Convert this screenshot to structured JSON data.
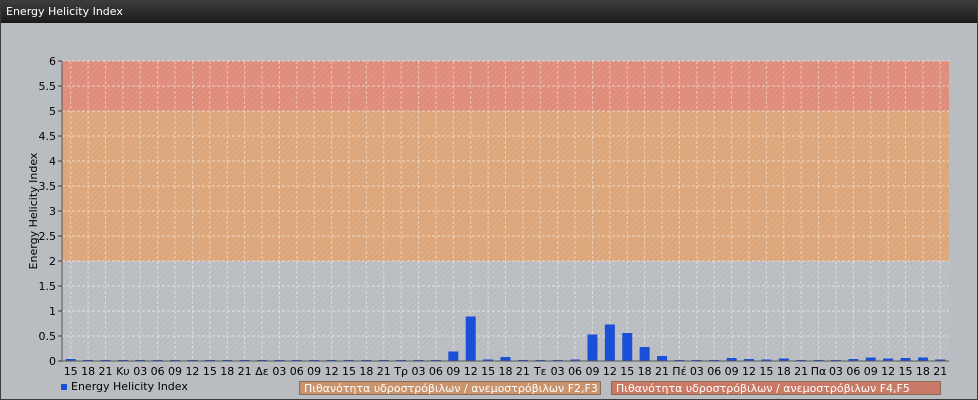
{
  "window": {
    "title": "Energy Helicity Index"
  },
  "colors": {
    "bar": "#1a4fd8",
    "zone_low": "#b9bdc1",
    "zone_f23": "#dca67a",
    "zone_f45": "#df8c7a"
  },
  "legend": {
    "series_label": "Energy Helicity Index",
    "zone_f23_label": "Πιθανότητα υδροστρόβιλων / ανεμοστρόβιλων F2,F3",
    "zone_f45_label": "Πιθανότητα υδροστρόβιλων / ανεμοστρόβιλων F4,F5"
  },
  "chart_data": {
    "type": "bar",
    "title": "Energy Helicity Index",
    "xlabel": "",
    "ylabel": "Energy Helicity Index",
    "ylim": [
      0,
      6
    ],
    "yticks": [
      "0",
      "0.5",
      "1",
      "1.5",
      "2",
      "2.5",
      "3",
      "3.5",
      "4",
      "4.5",
      "5",
      "5.5",
      "6"
    ],
    "grid": true,
    "bands": [
      {
        "from": 2,
        "to": 5,
        "label": "Πιθανότητα υδροστρόβιλων / ανεμοστρόβιλων F2,F3"
      },
      {
        "from": 5,
        "to": 6,
        "label": "Πιθανότητα υδροστρόβιλων / ανεμοστρόβιλων F4,F5"
      }
    ],
    "categories": [
      "15",
      "18",
      "21",
      "Κυ",
      "03",
      "06",
      "09",
      "12",
      "15",
      "18",
      "21",
      "Δε",
      "03",
      "06",
      "09",
      "12",
      "15",
      "18",
      "21",
      "Τρ",
      "03",
      "06",
      "09",
      "12",
      "15",
      "18",
      "21",
      "Τε",
      "03",
      "06",
      "09",
      "12",
      "15",
      "18",
      "21",
      "Πέ",
      "03",
      "06",
      "09",
      "12",
      "15",
      "18",
      "21",
      "Πα",
      "03",
      "06",
      "09",
      "12",
      "15",
      "18",
      "21"
    ],
    "series": [
      {
        "name": "Energy Helicity Index",
        "values": [
          0.04,
          0.02,
          0.02,
          0.02,
          0.02,
          0.02,
          0.02,
          0.02,
          0.02,
          0.02,
          0.02,
          0.02,
          0.02,
          0.02,
          0.02,
          0.02,
          0.02,
          0.02,
          0.02,
          0.02,
          0.02,
          0.02,
          0.19,
          0.89,
          0.03,
          0.08,
          0.02,
          0.02,
          0.02,
          0.03,
          0.53,
          0.73,
          0.56,
          0.28,
          0.1,
          0.02,
          0.02,
          0.02,
          0.06,
          0.04,
          0.03,
          0.05,
          0.02,
          0.02,
          0.02,
          0.04,
          0.07,
          0.05,
          0.06,
          0.07,
          0.03
        ]
      }
    ]
  }
}
